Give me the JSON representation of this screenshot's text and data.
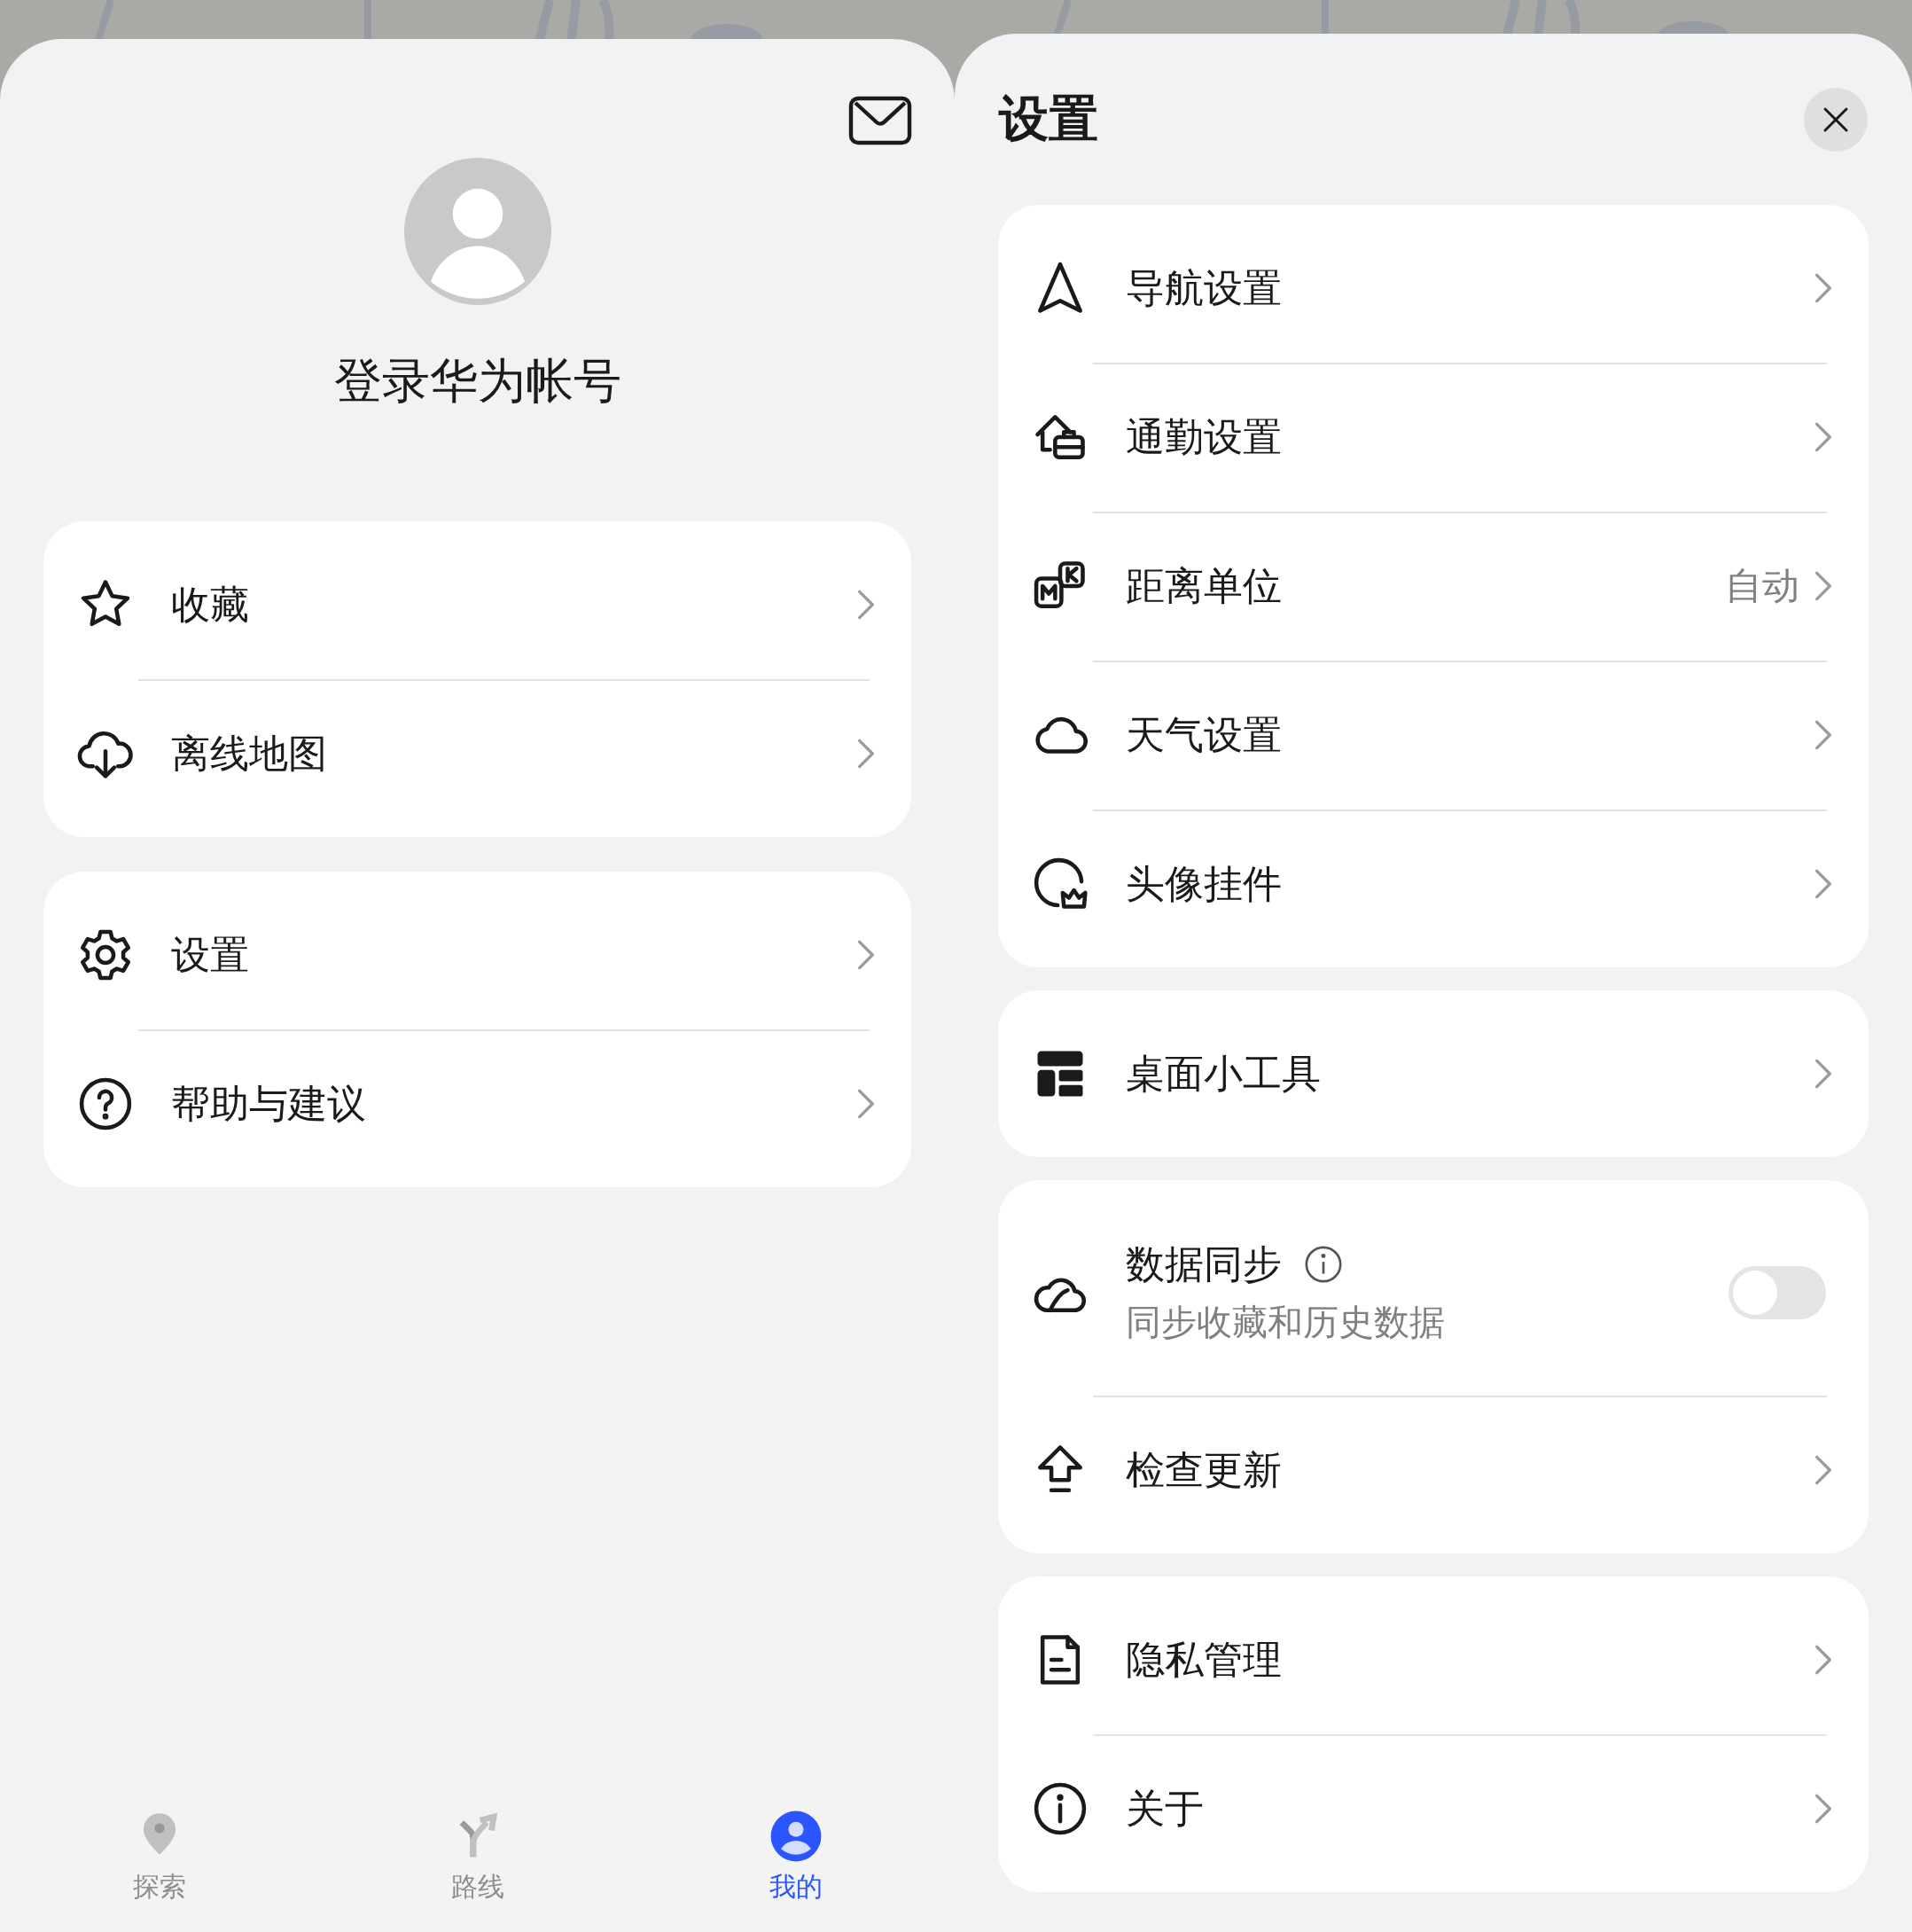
{
  "account": {
    "name": "登录华为帐号"
  },
  "account_menu": [
    {
      "items": [
        {
          "label": "收藏"
        },
        {
          "label": "离线地图"
        }
      ]
    },
    {
      "items": [
        {
          "label": "设置"
        },
        {
          "label": "帮助与建议"
        }
      ]
    }
  ],
  "bottom_nav": [
    {
      "label": "探索",
      "selected": false
    },
    {
      "label": "路线",
      "selected": false
    },
    {
      "label": "我的",
      "selected": true
    }
  ],
  "settings": {
    "title": "设置",
    "groups": [
      {
        "items": [
          {
            "kind": "link",
            "label": "导航设置"
          },
          {
            "kind": "link",
            "label": "通勤设置"
          },
          {
            "kind": "link",
            "label": "距离单位",
            "value": "自动"
          },
          {
            "kind": "link",
            "label": "天气设置"
          },
          {
            "kind": "link",
            "label": "头像挂件"
          }
        ]
      },
      {
        "items": [
          {
            "kind": "link",
            "label": "桌面小工具"
          }
        ]
      },
      {
        "items": [
          {
            "kind": "toggle",
            "label": "数据同步",
            "description": "同步收藏和历史数据",
            "on": false
          },
          {
            "kind": "link",
            "label": "检查更新"
          }
        ]
      },
      {
        "items": [
          {
            "kind": "link",
            "label": "隐私管理"
          },
          {
            "kind": "link",
            "label": "关于"
          }
        ]
      }
    ]
  }
}
